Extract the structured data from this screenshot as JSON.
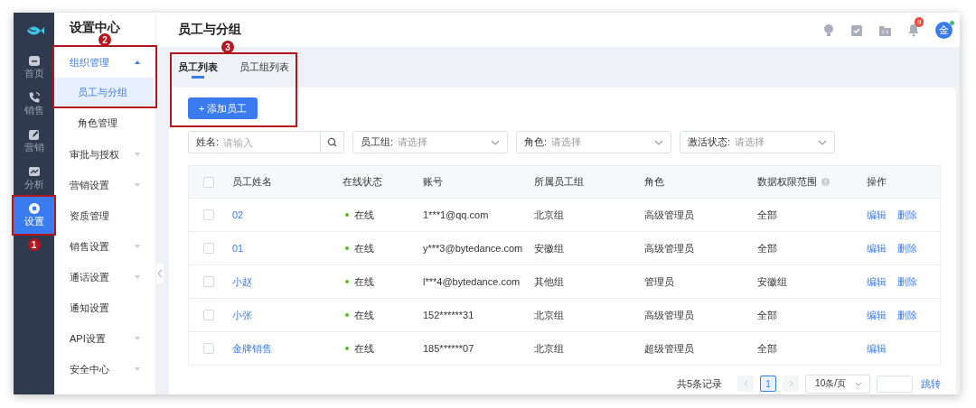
{
  "nav": {
    "items": [
      {
        "label": "首页",
        "selected": false
      },
      {
        "label": "销售",
        "selected": false
      },
      {
        "label": "营销",
        "selected": false
      },
      {
        "label": "分析",
        "selected": false
      },
      {
        "label": "设置",
        "selected": true,
        "annotation": "1"
      }
    ]
  },
  "menu": {
    "title": "设置中心",
    "items": [
      {
        "label": "组织管理",
        "expanded": true,
        "annotation": "2",
        "children": [
          {
            "label": "员工与分组",
            "selected": true
          },
          {
            "label": "角色管理",
            "selected": false
          }
        ]
      },
      {
        "label": "审批与授权",
        "expanded": false
      },
      {
        "label": "营销设置",
        "expanded": false
      },
      {
        "label": "资质管理"
      },
      {
        "label": "销售设置",
        "expanded": false
      },
      {
        "label": "通话设置",
        "expanded": false
      },
      {
        "label": "通知设置"
      },
      {
        "label": "API设置",
        "expanded": false
      },
      {
        "label": "安全中心",
        "expanded": false
      }
    ]
  },
  "header": {
    "title": "员工与分组",
    "notification_count": "9",
    "avatar": "金"
  },
  "tabs": [
    {
      "label": "员工列表",
      "selected": true
    },
    {
      "label": "员工组列表",
      "selected": false
    }
  ],
  "tabs_annotation": "3",
  "add_button": "+ 添加员工",
  "filters": [
    {
      "kind": "search",
      "label": "姓名:",
      "placeholder": "请输入"
    },
    {
      "kind": "select",
      "label": "员工组:",
      "placeholder": "请选择"
    },
    {
      "kind": "select",
      "label": "角色:",
      "placeholder": "请选择"
    },
    {
      "kind": "select",
      "label": "激活状态:",
      "placeholder": "请选择"
    }
  ],
  "table": {
    "header_checked": false,
    "columns": [
      "员工姓名",
      "在线状态",
      "账号",
      "所属员工组",
      "角色",
      "数据权限范围",
      "操作"
    ],
    "rows": [
      {
        "checked": false,
        "name": "02",
        "status": "在线",
        "account": "1***1@qq.com",
        "group": "北京组",
        "role": "高级管理员",
        "scope": "全部",
        "actions": [
          "编辑",
          "删除"
        ]
      },
      {
        "checked": false,
        "name": "01",
        "status": "在线",
        "account": "y***3@bytedance.com",
        "group": "安徽组",
        "role": "高级管理员",
        "scope": "全部",
        "actions": [
          "编辑",
          "删除"
        ]
      },
      {
        "checked": false,
        "name": "小赵",
        "status": "在线",
        "account": "l***4@bytedance.com",
        "group": "其他组",
        "role": "管理员",
        "scope": "安徽组",
        "actions": [
          "编辑",
          "删除"
        ]
      },
      {
        "checked": false,
        "name": "小张",
        "status": "在线",
        "account": "152******31",
        "group": "北京组",
        "role": "高级管理员",
        "scope": "全部",
        "actions": [
          "编辑",
          "删除"
        ]
      },
      {
        "checked": false,
        "name": "金牌销售",
        "status": "在线",
        "account": "185******07",
        "group": "北京组",
        "role": "超级管理员",
        "scope": "全部",
        "actions": [
          "编辑"
        ]
      }
    ]
  },
  "pagination": {
    "total": "共5条记录",
    "pages": [
      {
        "label": "1",
        "selected": true
      }
    ],
    "page_size": "10条/页",
    "jump": "跳转"
  }
}
